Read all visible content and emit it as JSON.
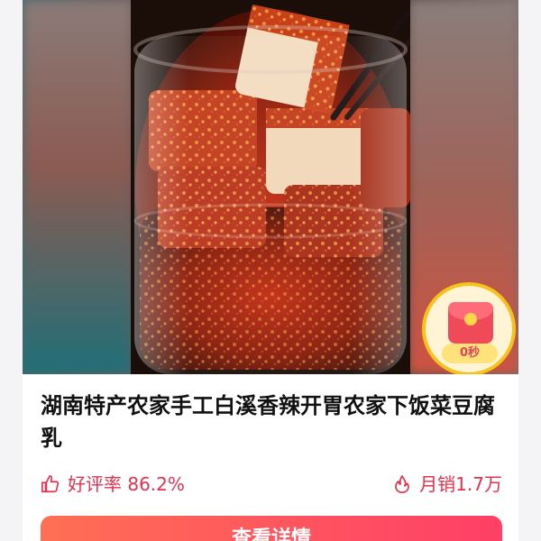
{
  "product": {
    "title": "湖南特产农家手工白溪香辣开胃农家下饭菜豆腐乳",
    "image_icon": "product-photo"
  },
  "promo": {
    "countdown": "0秒",
    "icon": "red-envelope-icon"
  },
  "stats": {
    "rating_icon": "thumbs-up-icon",
    "rating_text": "好评率 86.2%",
    "sales_icon": "flame-icon",
    "sales_text": "月销1.7万"
  },
  "colors": {
    "accent": "#e5304e",
    "cta_start": "#ff6f55",
    "cta_end": "#ff3f67",
    "badge_ring": "#f7c21a"
  },
  "cta": {
    "label": "查看详情"
  }
}
